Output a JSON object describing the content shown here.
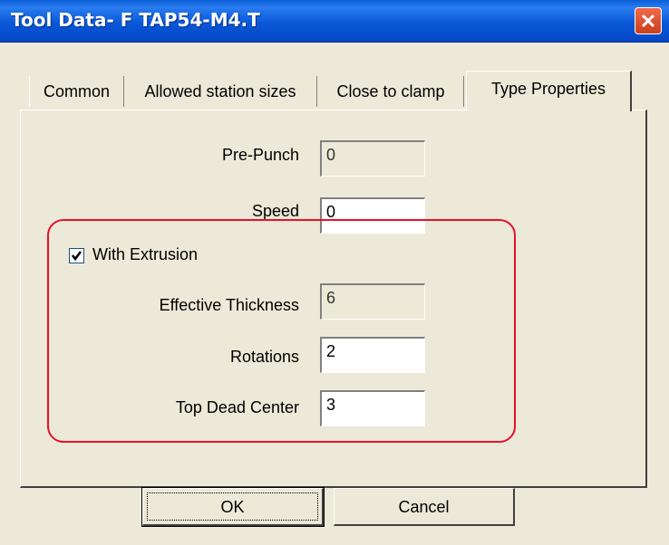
{
  "window": {
    "title": "Tool Data- F TAP54-M4.T"
  },
  "tabs": [
    {
      "label": "Common"
    },
    {
      "label": "Allowed station sizes"
    },
    {
      "label": "Close to clamp"
    },
    {
      "label": "Type Properties",
      "active": true
    }
  ],
  "fields": {
    "pre_punch": {
      "label": "Pre-Punch",
      "value": "0",
      "enabled": false
    },
    "speed": {
      "label": "Speed",
      "value": "0",
      "enabled": true
    },
    "with_extrusion": {
      "label": "With Extrusion",
      "checked": true
    },
    "effective_thickness": {
      "label": "Effective Thickness",
      "value": "6",
      "enabled": false
    },
    "rotations": {
      "label": "Rotations",
      "value": "2",
      "enabled": true
    },
    "top_dead_center": {
      "label": "Top Dead Center",
      "value": "3",
      "enabled": true
    }
  },
  "buttons": {
    "ok": "OK",
    "cancel": "Cancel"
  },
  "colors": {
    "title_bar": "#0a58d8",
    "dialog_bg": "#ece9d8",
    "highlight_annotation": "#e8102a",
    "close_button": "#d9542f"
  }
}
